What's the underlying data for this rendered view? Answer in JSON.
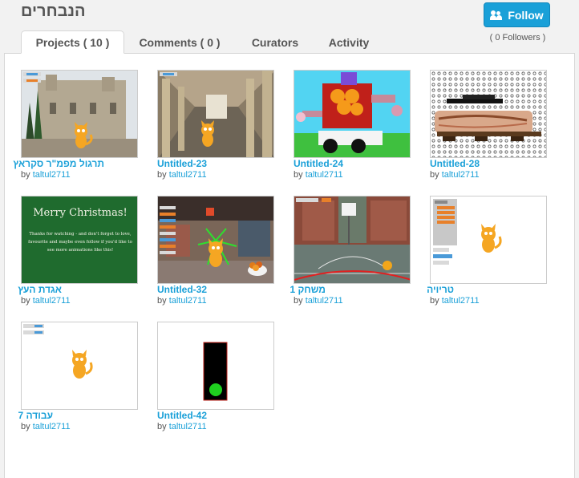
{
  "studio": {
    "title": "הנבחרים",
    "follow_label": "Follow",
    "followers_text": "( 0 Followers )"
  },
  "tabs": [
    {
      "label": "Projects ( 10 )",
      "active": true
    },
    {
      "label": "Comments ( 0 )",
      "active": false
    },
    {
      "label": "Curators",
      "active": false
    },
    {
      "label": "Activity",
      "active": false
    }
  ],
  "projects": [
    {
      "title": "תרגול מפמ\"ר סקראץ",
      "by": "by",
      "owner": "taltul2711",
      "thumbnail": "palace-courtyard"
    },
    {
      "title": "Untitled-23",
      "by": "by",
      "owner": "taltul2711",
      "thumbnail": "arcade-corridor"
    },
    {
      "title": "Untitled-24",
      "by": "by",
      "owner": "taltul2711",
      "thumbnail": "robot-truck"
    },
    {
      "title": "Untitled-28",
      "by": "by",
      "owner": "taltul2711",
      "thumbnail": "table-pattern"
    },
    {
      "title": "אגדת העץ",
      "by": "by",
      "owner": "taltul2711",
      "thumbnail": "christmas-card"
    },
    {
      "title": "Untitled-32",
      "by": "by",
      "owner": "taltul2711",
      "thumbnail": "cat-market"
    },
    {
      "title": "משחק 1",
      "by": "by",
      "owner": "taltul2711",
      "thumbnail": "basketball-court"
    },
    {
      "title": "טריויה",
      "by": "by",
      "owner": "taltul2711",
      "thumbnail": "cat-code"
    },
    {
      "title": "עבודה 7",
      "by": "by",
      "owner": "taltul2711",
      "thumbnail": "cat-white"
    },
    {
      "title": "Untitled-42",
      "by": "by",
      "owner": "taltul2711",
      "thumbnail": "traffic-light"
    }
  ],
  "thumb_text": {
    "christmas_title": "Merry Christmas!",
    "christmas_body_1": "Thanks for watching - and don't forget to love,",
    "christmas_body_2": "favourite and maybe even follow if you'd like to",
    "christmas_body_3": "see more animations like this!"
  },
  "colors": {
    "accent": "#1aa0d8",
    "follow_bg": "#1aa0d8",
    "christmas_bg": "#1f6b2e"
  }
}
